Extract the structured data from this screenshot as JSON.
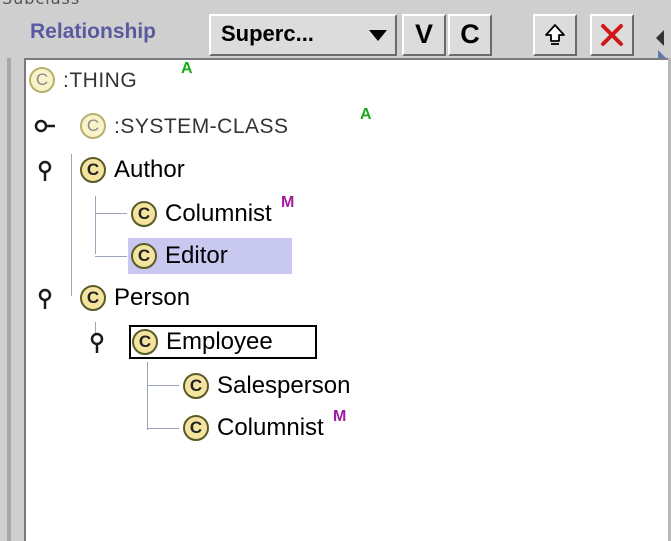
{
  "top_strip": {
    "text": "Subclass"
  },
  "toolbar": {
    "relationship_label": "Relationship",
    "relation_combo": {
      "selected": "Superc...",
      "arrow_icon": "dropdown-arrow-icon"
    },
    "buttons": [
      {
        "name": "view-button",
        "label": "V"
      },
      {
        "name": "create-button",
        "label": "C"
      },
      {
        "name": "up-button",
        "icon": "up-arrow-icon"
      },
      {
        "name": "delete-button",
        "icon": "red-x-icon"
      }
    ]
  },
  "tree": {
    "badge_letter": "C",
    "nodes": [
      {
        "id": "thing",
        "label": ":THING",
        "flag": "A",
        "system": true
      },
      {
        "id": "system-class",
        "label": ":SYSTEM-CLASS",
        "flag": "A",
        "system": true
      },
      {
        "id": "author",
        "label": "Author"
      },
      {
        "id": "columnist-1",
        "label": "Columnist",
        "flag": "M"
      },
      {
        "id": "editor",
        "label": "Editor",
        "selected": true
      },
      {
        "id": "person",
        "label": "Person"
      },
      {
        "id": "employee",
        "label": "Employee",
        "focused": true
      },
      {
        "id": "salesperson",
        "label": "Salesperson"
      },
      {
        "id": "columnist-2",
        "label": "Columnist",
        "flag": "M"
      }
    ]
  },
  "colors": {
    "relationship_label": "#5a5aa0",
    "badge_fill": "#f4e4a0",
    "flag_a": "#1aa81a",
    "flag_m": "#a01aa0",
    "delete_x": "#d01818",
    "selection": "#c8c8f0"
  }
}
